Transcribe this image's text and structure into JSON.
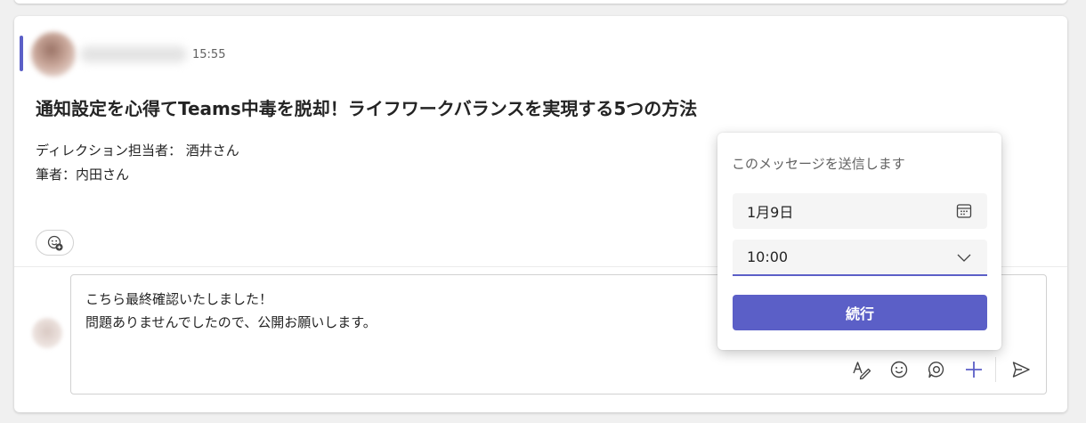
{
  "colors": {
    "accent": "#5b5fc7",
    "background": "#f0f0f0",
    "card": "#ffffff"
  },
  "message": {
    "time": "15:55",
    "title": "通知設定を心得てTeams中毒を脱却！ライフワークバランスを実現する5つの方法",
    "lines": [
      "ディレクション担当者： 酒井さん",
      "筆者：内田さん"
    ],
    "reaction_icon": "add-reaction-icon"
  },
  "reply": {
    "lines": [
      "こちら最終確認いたしました！",
      "問題ありませんでしたので、公開お願いします。"
    ],
    "tools": [
      "format-icon",
      "emoji-icon",
      "loop-icon",
      "plus-icon",
      "send-icon"
    ]
  },
  "schedule_popup": {
    "heading": "このメッセージを送信します",
    "date_value": "1月9日",
    "time_value": "10:00",
    "continue_label": "続行"
  }
}
